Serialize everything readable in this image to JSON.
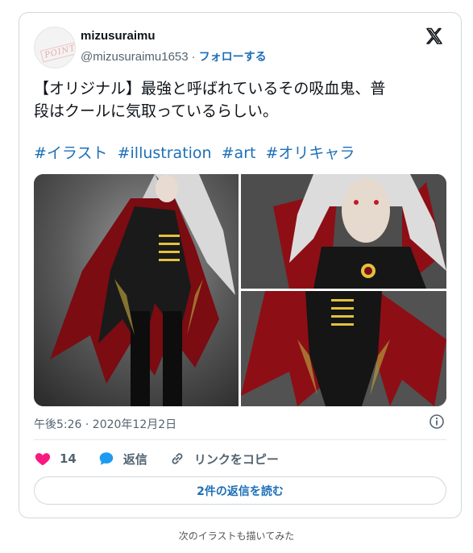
{
  "tweet": {
    "user_name": "mizusuraimu",
    "handle": "@mizusuraimu1653",
    "separator": "·",
    "follow_label": "フォローする",
    "avatar_stamp": "POINT",
    "text_line1": "【オリジナル】最強と呼ばれているその吸血鬼、普",
    "text_line2": "段はクールに気取っているらしい。",
    "hashtags": [
      "#イラスト",
      "#illustration",
      "#art",
      "#オリキャラ"
    ],
    "timestamp": "午後5:26 · 2020年12月2日",
    "actions": {
      "like_count": "14",
      "reply_label": "返信",
      "copy_link_label": "リンクをコピー"
    },
    "read_replies_label": "2件の返信を読む"
  },
  "caption": "次のイラストも描いてみた",
  "icons": {
    "x_logo": "x-logo-icon",
    "info": "info-icon",
    "like": "heart-icon",
    "reply": "speech-bubble-icon",
    "link": "link-icon"
  },
  "colors": {
    "link_blue": "#1d6fb8",
    "like_pink": "#f91880",
    "reply_blue": "#1d9bf0",
    "muted_text": "#536471",
    "border": "#cfd9de"
  }
}
